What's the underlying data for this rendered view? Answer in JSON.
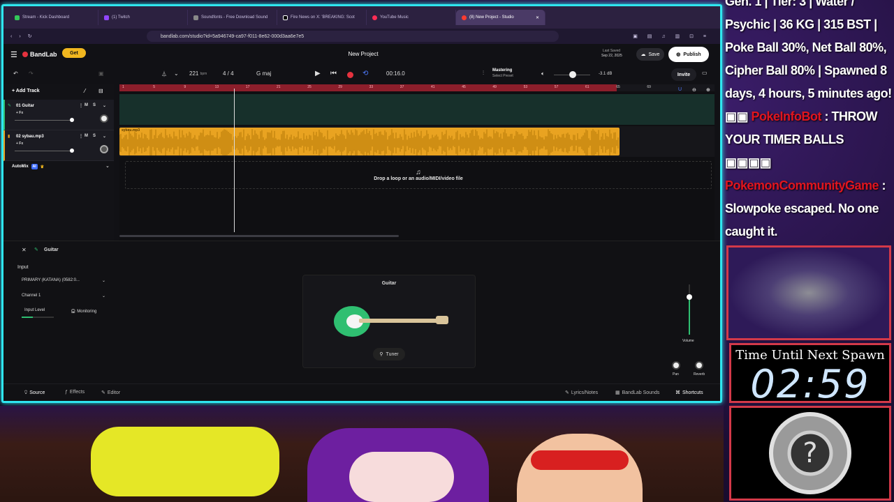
{
  "browser": {
    "tabs": [
      {
        "label": "Stream - Kick Dashboard",
        "color": "#34c759"
      },
      {
        "label": "(1) Twitch",
        "color": "#9146ff"
      },
      {
        "label": "Soundfonts - Free Download Sound",
        "color": "#777"
      },
      {
        "label": "Fire News on X: 'BREAKING: Scot",
        "color": "#000"
      },
      {
        "label": "YouTube Music",
        "color": "#ff2d55"
      },
      {
        "label": "(8) New Project - Studio",
        "color": "#ff3b30"
      }
    ],
    "url": "bandlab.com/studio?id=5a946749-ca97-f011-8e62-000d3aa6e7e5"
  },
  "app": {
    "brand": "BandLab",
    "get_label": "Get",
    "project_title": "New Project",
    "last_saved_label": "Last Saved",
    "last_saved_date": "Sep 22, 2025",
    "save_label": "Save",
    "publish_label": "Publish",
    "invite_label": "Invite",
    "bpm_value": "221",
    "bpm_unit": "bpm",
    "time_signature": "4 / 4",
    "key": "G maj",
    "time_display": "00:16.0",
    "mastering_label": "Mastering",
    "mastering_preset": "Select Preset",
    "master_volume": "-3.1 dB",
    "add_track_label": "Add Track",
    "tracks": [
      {
        "name": "01  Guitar",
        "fx": "+ Fx",
        "mute": "M",
        "solo": "S"
      },
      {
        "name": "02  sybau.mp3",
        "fx": "+ Fx",
        "mute": "M",
        "solo": "S"
      }
    ],
    "automix_label": "AutoMix",
    "automix_badge": "AI",
    "clip_name": "sybau.mp3",
    "dropzone_text": "Drop a loop or an audio/MIDI/video file",
    "ruler_ticks": [
      "1",
      "5",
      "9",
      "13",
      "17",
      "21",
      "25",
      "29",
      "33",
      "37",
      "41",
      "45",
      "49",
      "53",
      "57",
      "61",
      "65",
      "69"
    ]
  },
  "detail": {
    "track_name": "Guitar",
    "input_label": "Input",
    "input_device": "PRIMARY (KATANA) (0582:0...",
    "channel": "Channel 1",
    "input_level_label": "Input Level",
    "monitoring_label": "Monitoring",
    "instrument_title": "Guitar",
    "tuner_label": "Tuner",
    "volume_label": "Volume",
    "pan_label": "Pan",
    "reverb_label": "Reverb",
    "source_tab": "Source",
    "effects_tab": "Effects",
    "editor_tab": "Editor",
    "lyrics_label": "Lyrics/Notes",
    "sounds_label": "BandLab Sounds",
    "shortcuts_label": "Shortcuts"
  },
  "stream": {
    "chat_top": "Gen. 1 | Tier: 3 | Water / Psychic | 36 KG | 315 BST | Poke Ball 30%, Net Ball 80%, Cipher Ball 80% | Spawned 8 days, 4 hours, 5 minutes ago!",
    "chat_user_1": "PokeInfoBot",
    "chat_msg_1": "THROW YOUR TIMER BALLS",
    "chat_user_2": "PokemonCommunityGame",
    "chat_msg_2": "Slowpoke escaped. No one caught it.",
    "timer_label": "Time Until Next Spawn",
    "timer_value": "02:59"
  },
  "colors": {
    "accent": "#2fe6ef",
    "bandlab_red": "#e5323e",
    "clip_orange": "#e9a321",
    "guitar_green": "#2fbf71",
    "frame_red": "#d33949"
  }
}
